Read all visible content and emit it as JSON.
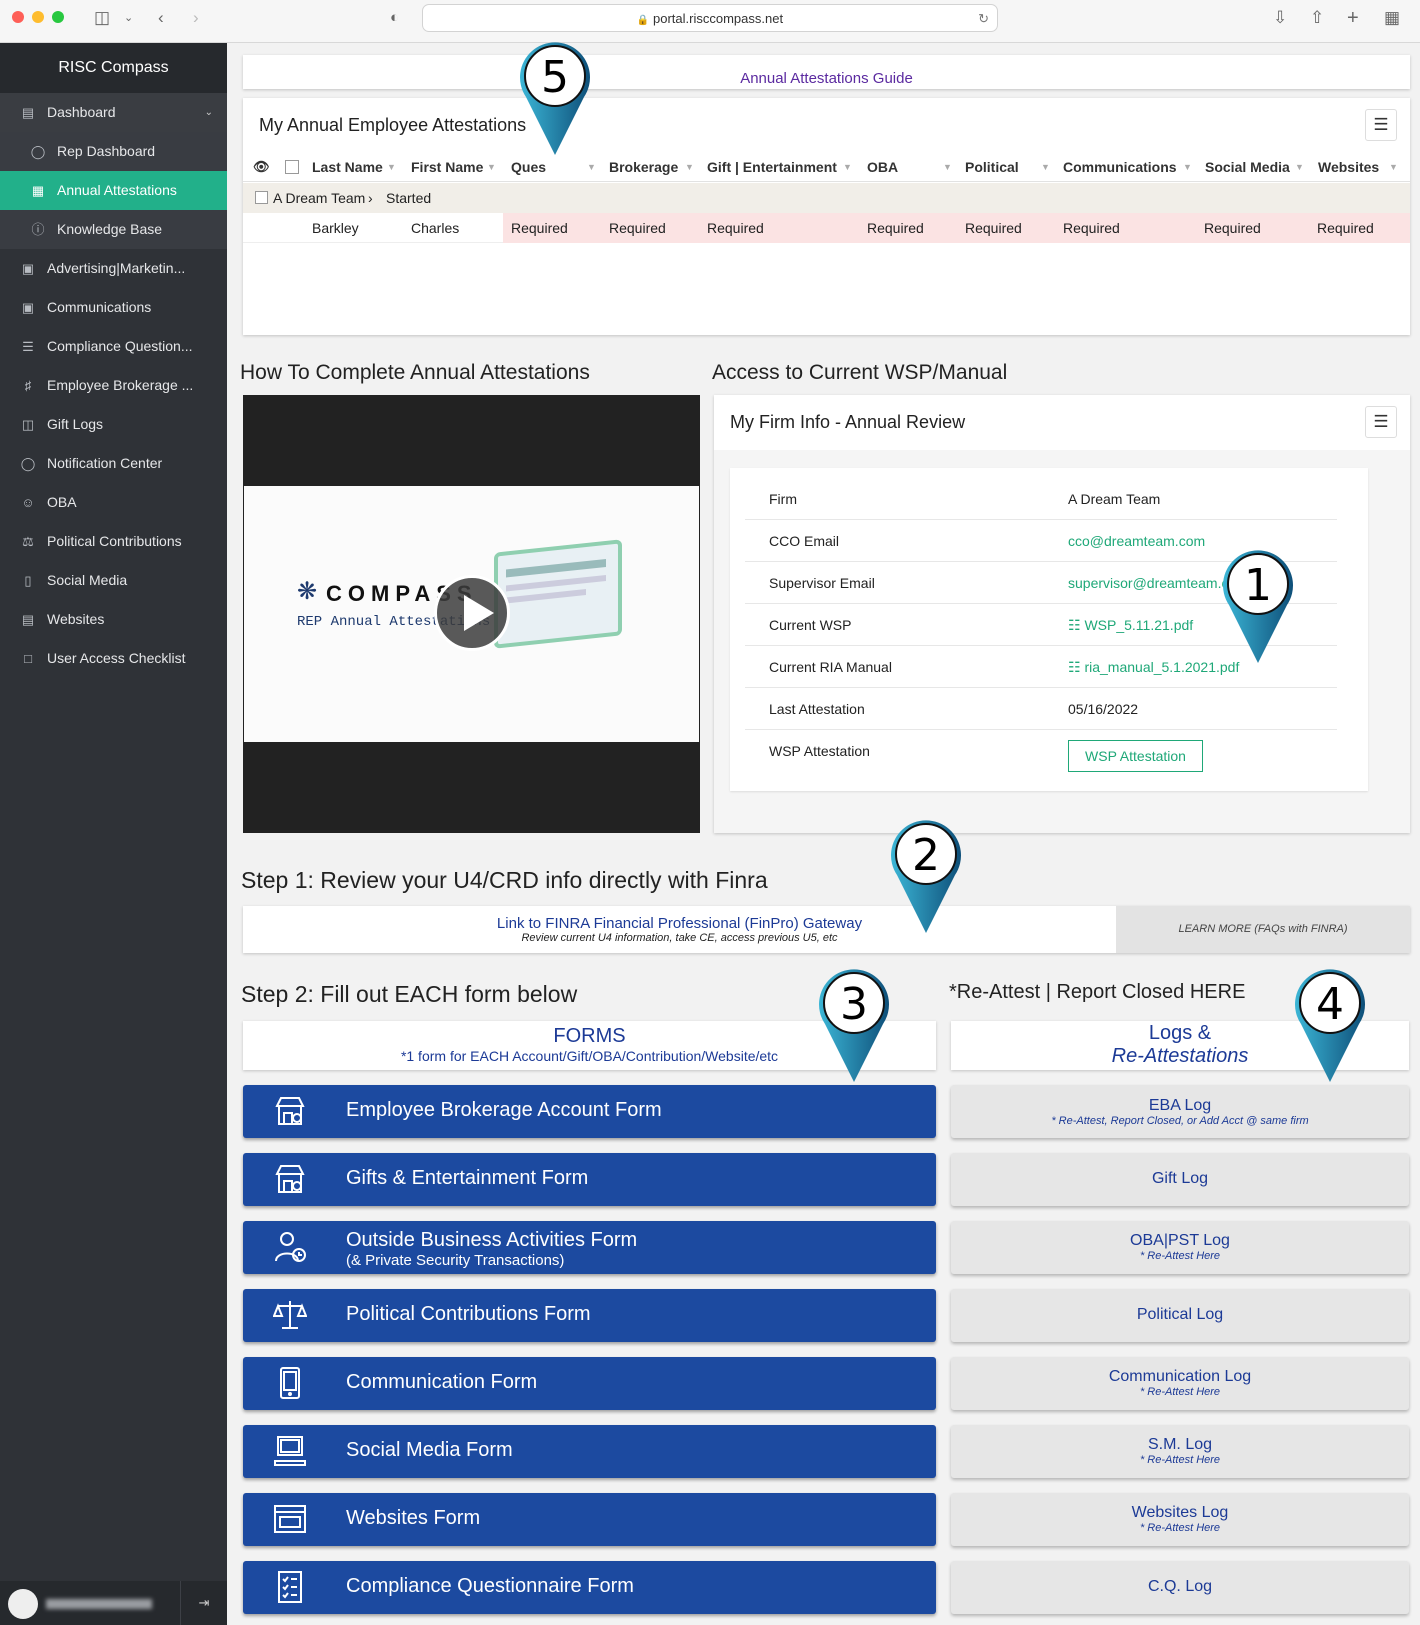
{
  "browser": {
    "url": "portal.risccompass.net"
  },
  "sidebar": {
    "brand": "RISC Compass",
    "items": [
      {
        "label": "Dashboard",
        "icon": "dashboard-icon"
      },
      {
        "label": "Rep Dashboard",
        "icon": "gauge-icon"
      },
      {
        "label": "Annual Attestations",
        "icon": "table-icon"
      },
      {
        "label": "Knowledge Base",
        "icon": "info-icon"
      },
      {
        "label": "Advertising|Marketin...",
        "icon": "document-icon"
      },
      {
        "label": "Communications",
        "icon": "document-icon"
      },
      {
        "label": "Compliance Question...",
        "icon": "checklist-icon"
      },
      {
        "label": "Employee Brokerage ...",
        "icon": "bank-icon"
      },
      {
        "label": "Gift Logs",
        "icon": "gift-icon"
      },
      {
        "label": "Notification Center",
        "icon": "chat-icon"
      },
      {
        "label": "OBA",
        "icon": "users-icon"
      },
      {
        "label": "Political Contributions",
        "icon": "scale-icon"
      },
      {
        "label": "Social Media",
        "icon": "phone-icon"
      },
      {
        "label": "Websites",
        "icon": "browser-icon"
      },
      {
        "label": "User Access Checklist",
        "icon": "clipboard-icon"
      }
    ]
  },
  "guide_link": "Annual Attestations Guide",
  "attestations": {
    "title": "My Annual Employee Attestations",
    "columns": [
      "Last Name",
      "First Name",
      "Ques",
      "Brokerage",
      "Gift | Entertainment",
      "OBA",
      "Political",
      "Communications",
      "Social Media",
      "Websites"
    ],
    "group": {
      "name": "A Dream Team",
      "status": "Started"
    },
    "row": {
      "last": "Barkley",
      "first": "Charles",
      "statuses": [
        "Required",
        "Required",
        "Required",
        "Required",
        "Required",
        "Required",
        "Required",
        "Required"
      ]
    }
  },
  "how_to": {
    "title": "How To Complete Annual Attestations",
    "video_brand": "COMPASS",
    "video_sub": "REP Annual Attestations"
  },
  "wsp": {
    "title": "Access to Current WSP/Manual",
    "card_title": "My Firm Info - Annual Review",
    "rows": [
      {
        "label": "Firm",
        "value": "A Dream Team"
      },
      {
        "label": "CCO Email",
        "value": "cco@dreamteam.com"
      },
      {
        "label": "Supervisor Email",
        "value": "supervisor@dreamteam.com"
      },
      {
        "label": "Current WSP",
        "value": "WSP_5.11.21.pdf"
      },
      {
        "label": "Current RIA Manual",
        "value": "ria_manual_5.1.2021.pdf"
      },
      {
        "label": "Last Attestation",
        "value": "05/16/2022"
      },
      {
        "label": "WSP Attestation",
        "value": "WSP Attestation"
      }
    ]
  },
  "step1": {
    "title": "Step 1: Review your U4/CRD info directly with Finra",
    "link": "Link to FINRA Financial Professional (FinPro) Gateway",
    "link_sub": "Review current U4 information, take CE, access previous U5, etc",
    "learn_more": "LEARN MORE (FAQs with FINRA)"
  },
  "step2": {
    "title": "Step 2: Fill out EACH form below",
    "forms_title": "FORMS",
    "forms_sub": "*1 form for EACH Account/Gift/OBA/Contribution/Website/etc",
    "reattest_title": "*Re-Attest | Report Closed HERE",
    "logs_title_1": "Logs &",
    "logs_title_2": "Re-Attestations",
    "forms": [
      {
        "label": "Employee Brokerage Account Form",
        "sub": "",
        "icon": "storefront-icon"
      },
      {
        "label": "Gifts & Entertainment Form",
        "sub": "",
        "icon": "storefront-icon"
      },
      {
        "label": "Outside Business Activities Form",
        "sub": "(& Private Security Transactions)",
        "icon": "user-clock-icon"
      },
      {
        "label": "Political Contributions Form",
        "sub": "",
        "icon": "scale-icon"
      },
      {
        "label": "Communication Form",
        "sub": "",
        "icon": "tablet-icon"
      },
      {
        "label": "Social Media Form",
        "sub": "",
        "icon": "laptop-icon"
      },
      {
        "label": "Websites Form",
        "sub": "",
        "icon": "browser-icon"
      },
      {
        "label": "Compliance Questionnaire Form",
        "sub": "",
        "icon": "checklist-icon"
      }
    ],
    "logs": [
      {
        "label": "EBA Log",
        "sub": "* Re-Attest, Report Closed, or Add Acct @ same firm"
      },
      {
        "label": "Gift Log",
        "sub": ""
      },
      {
        "label": "OBA|PST Log",
        "sub": "* Re-Attest Here"
      },
      {
        "label": "Political Log",
        "sub": ""
      },
      {
        "label": "Communication Log",
        "sub": "* Re-Attest Here"
      },
      {
        "label": "S.M. Log",
        "sub": "* Re-Attest Here"
      },
      {
        "label": "Websites Log",
        "sub": "* Re-Attest Here"
      },
      {
        "label": "C.Q. Log",
        "sub": ""
      }
    ]
  },
  "markers": [
    "5",
    "1",
    "2",
    "3",
    "4"
  ],
  "colors": {
    "sidebar": "#2f3237",
    "active": "#22b08a",
    "form_button": "#1c4aa0",
    "pin": "#1d6f9c",
    "required": "#fbe3e3"
  }
}
